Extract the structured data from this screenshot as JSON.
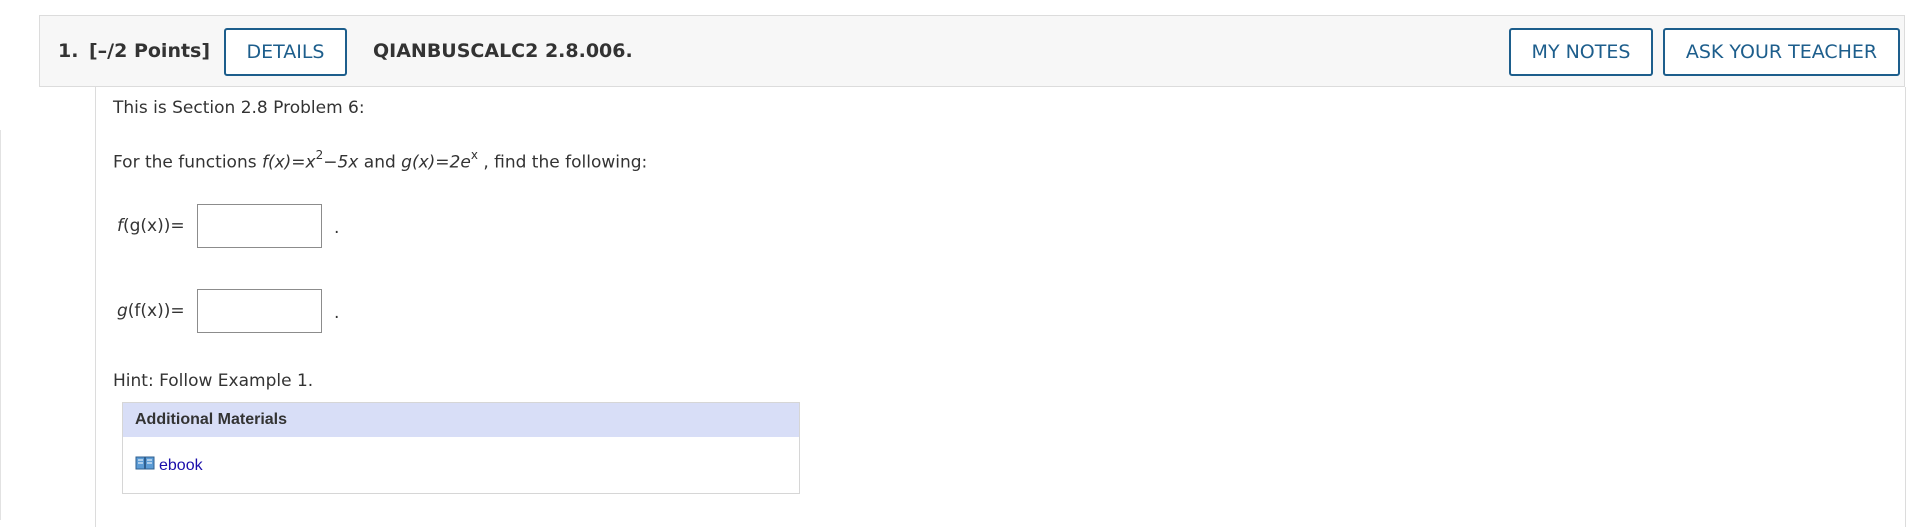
{
  "question": {
    "number": "1.",
    "points": "[–/2 Points]",
    "details_label": "DETAILS",
    "code": "QIANBUSCALC2 2.8.006.",
    "my_notes_label": "MY NOTES",
    "ask_teacher_label": "ASK YOUR TEACHER"
  },
  "body": {
    "intro": "This is Section 2.8 Problem 6:",
    "functions_prefix": "For the functions ",
    "f_def": "f(x)=x",
    "f_exp": "2",
    "f_tail": "−5x",
    "and_word": " and ",
    "g_def": "g(x)=2e",
    "g_exp": "x",
    "functions_suffix": " , find the following:",
    "answer1_label_left": "f",
    "answer1_label_rest": "(g(x))=",
    "answer1_value": "",
    "answer2_label_left": "g",
    "answer2_label_rest": "(f(x))=",
    "answer2_value": "",
    "period": ".",
    "hint": "Hint: Follow Example 1."
  },
  "materials": {
    "title": "Additional Materials",
    "ebook_label": "ebook",
    "icon": "book-icon"
  }
}
